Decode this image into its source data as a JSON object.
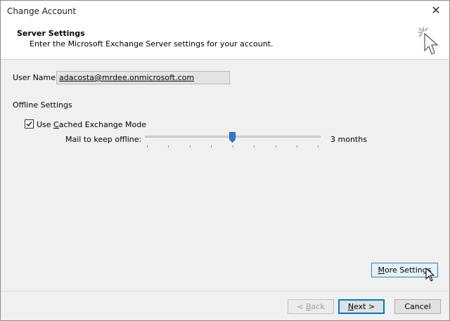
{
  "window": {
    "title": "Change Account"
  },
  "header": {
    "title": "Server Settings",
    "subtitle": "Enter the Microsoft Exchange Server settings for your account.",
    "icon": "cursor-click-icon"
  },
  "account": {
    "user_name_label": "User Name:",
    "user_name_value": "adacosta@mrdee.onmicrosoft.com"
  },
  "offline": {
    "section_label": "Offline Settings",
    "cached_mode": {
      "label_pre": "Use ",
      "label_accel": "C",
      "label_post": "ached Exchange Mode",
      "checked": true
    },
    "mail_offline_label": "Mail to keep offline:",
    "mail_offline_value": "3 months",
    "slider_position_fraction": 0.5
  },
  "buttons": {
    "more_settings": {
      "accel": "M",
      "rest": "ore Settings"
    },
    "back": {
      "pre": "< ",
      "accel": "B",
      "rest": "ack",
      "enabled": false
    },
    "next": {
      "accel": "N",
      "rest": "ext >"
    },
    "cancel": "Cancel"
  },
  "colors": {
    "accent": "#0078d7",
    "slider_thumb": "#2c7cd6"
  }
}
